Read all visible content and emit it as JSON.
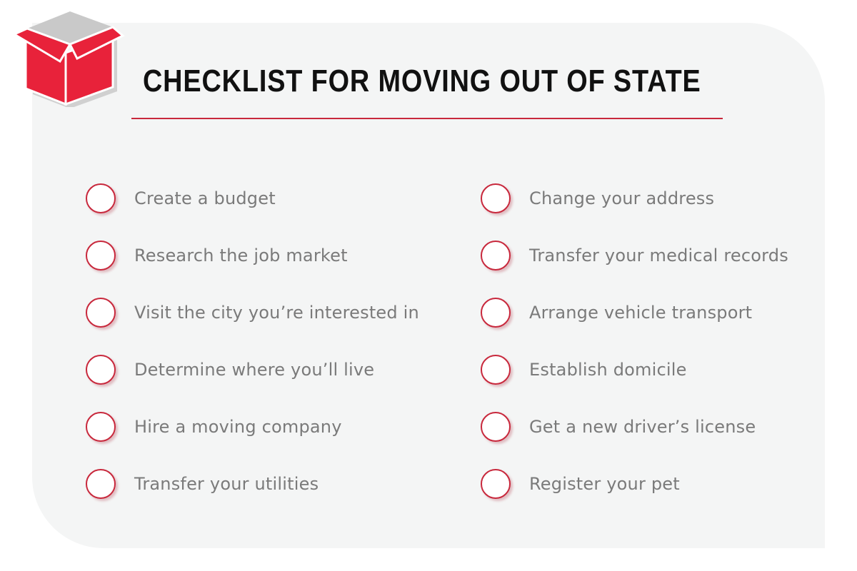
{
  "header": {
    "icon": "open-box-icon",
    "title": "CHECKLIST FOR MOVING OUT OF STATE"
  },
  "colors": {
    "accent": "#e8223a",
    "checkbox_border": "#c8283c",
    "card_background": "#f4f5f5",
    "text": "#7a7a7a",
    "title": "#111111"
  },
  "checklist": {
    "left": [
      {
        "label": "Create a budget",
        "checked": false
      },
      {
        "label": "Research the job market",
        "checked": false
      },
      {
        "label": "Visit the city you’re interested in",
        "checked": false
      },
      {
        "label": "Determine where you’ll live",
        "checked": false
      },
      {
        "label": "Hire a moving company",
        "checked": false
      },
      {
        "label": "Transfer your utilities",
        "checked": false
      }
    ],
    "right": [
      {
        "label": "Change your address",
        "checked": false
      },
      {
        "label": "Transfer your medical records",
        "checked": false
      },
      {
        "label": "Arrange vehicle transport",
        "checked": false
      },
      {
        "label": "Establish domicile",
        "checked": false
      },
      {
        "label": "Get a new driver’s license",
        "checked": false
      },
      {
        "label": "Register your pet",
        "checked": false
      }
    ]
  }
}
